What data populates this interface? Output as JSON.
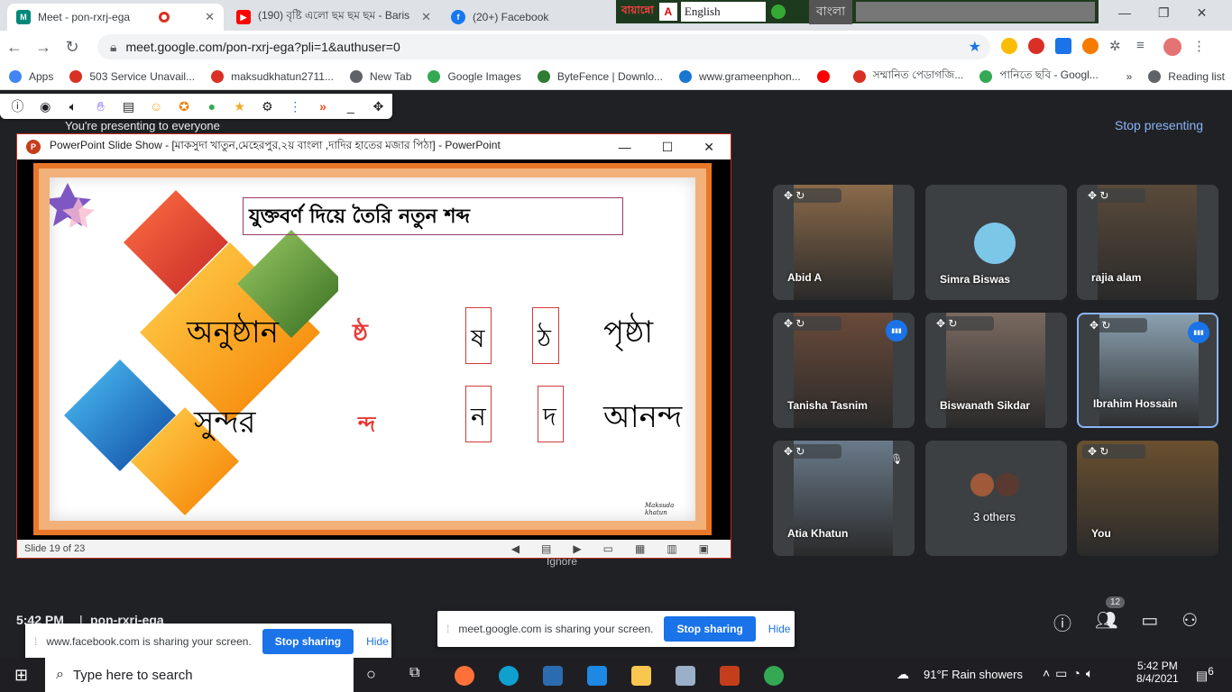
{
  "tabs": [
    {
      "title": "Meet - pon-rxrj-ega",
      "active": true,
      "close": "✕"
    },
    {
      "title": "(190) বৃষ্টি এলো ছম ছম ছম - Baris",
      "active": false,
      "close": "✕"
    },
    {
      "title": "(20+) Facebook",
      "active": false,
      "close": ""
    }
  ],
  "ime": {
    "lang_label": "বায়ান্নো",
    "select": "English",
    "mode": "বাংলা"
  },
  "address": {
    "url": "meet.google.com/pon-rxrj-ega?pli=1&authuser=0"
  },
  "bookmarks": [
    {
      "label": "Apps",
      "color": "#4285f4"
    },
    {
      "label": "503 Service Unavail...",
      "color": "#d93025"
    },
    {
      "label": "maksudkhatun2711...",
      "color": "#d93025"
    },
    {
      "label": "New Tab",
      "color": "#5f6368"
    },
    {
      "label": "Google Images",
      "color": "#34a853"
    },
    {
      "label": "ByteFence | Downlo...",
      "color": "#2e7d32"
    },
    {
      "label": "www.grameenphon...",
      "color": "#1976d2"
    },
    {
      "label": "",
      "color": "#ff0000"
    },
    {
      "label": "সম্মানিত পেডাগজি...",
      "color": "#d93025"
    },
    {
      "label": "পানিতে ছবি - Googl...",
      "color": "#34a853"
    },
    {
      "label": "»",
      "color": "transparent"
    },
    {
      "label": "Reading list",
      "color": "#5f6368"
    }
  ],
  "meet": {
    "presenting_text": "You're presenting to everyone",
    "stop_presenting": "Stop presenting",
    "time": "5:42 PM",
    "separator": "|",
    "meeting_code": "pon-rxrj-ega",
    "people_count": "12",
    "ignore_label": "Ignore"
  },
  "ppt": {
    "title": "PowerPoint Slide Show - [মাকসুদা খাতুন,মেহেরপুর,২য় বাংলা ,দাদির হাতের মজার পিঠা] - PowerPoint",
    "slide_status": "Slide 19 of 23",
    "slide": {
      "heading": "যুক্তবর্ণ দিয়ে তৈরি নতুন শব্দ",
      "word1": "অনুষ্ঠান",
      "conj1": "ষ্ঠ",
      "letter1a": "ষ",
      "letter1b": "ঠ",
      "result1": "পৃষ্ঠা",
      "word2": "সুন্দর",
      "conj2": "ন্দ",
      "letter2a": "ন",
      "letter2b": "দ",
      "result2": "আনন্দ",
      "signature": "Maksuda khatun"
    }
  },
  "participants": [
    {
      "name": "Abid A",
      "bg": "#8a6a4a"
    },
    {
      "name": "Simra Biswas",
      "bg": "#3c4043"
    },
    {
      "name": "rajia alam",
      "bg": "#5a4a3a"
    },
    {
      "name": "Tanisha Tasnim",
      "bg": "#6a4a3a"
    },
    {
      "name": "Biswanath Sikdar",
      "bg": "#7a6a60"
    },
    {
      "name": "Ibrahim Hossain",
      "bg": "#8aa0b0"
    },
    {
      "name": "Atia Khatun",
      "bg": "#6a7a8a"
    },
    {
      "name": "3 others",
      "bg": "#3c4043"
    },
    {
      "name": "You",
      "bg": "#6a5030"
    }
  ],
  "share_bars": [
    {
      "text": "www.facebook.com is sharing your screen.",
      "stop": "Stop sharing",
      "hide": "Hide"
    },
    {
      "text": "meet.google.com is sharing your screen.",
      "stop": "Stop sharing",
      "hide": "Hide"
    }
  ],
  "taskbar": {
    "search_placeholder": "Type here to search",
    "weather": "91°F  Rain showers",
    "time": "5:42 PM",
    "date": "8/4/2021",
    "notif": "6"
  },
  "colors": {
    "accent": "#1a73e8",
    "meet_bg": "#202124",
    "slide_border": "#e9772a"
  }
}
